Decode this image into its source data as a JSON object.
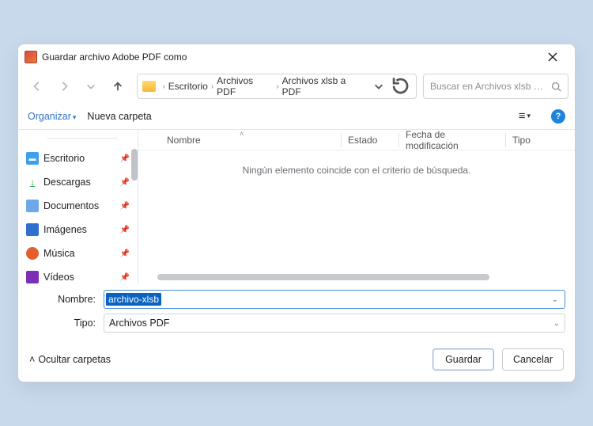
{
  "window_title": "Guardar archivo Adobe PDF como",
  "nav": {
    "path_segments": [
      "Escritorio",
      "Archivos PDF",
      "Archivos xlsb a PDF"
    ],
    "search_placeholder": "Buscar en Archivos xlsb a PDF"
  },
  "toolbar": {
    "organize": "Organizar",
    "new_folder": "Nueva carpeta"
  },
  "sidebar": {
    "items": [
      {
        "label": "Escritorio",
        "color": "#3aa0ef",
        "glyph": "🖥"
      },
      {
        "label": "Descargas",
        "color": "#34a853",
        "glyph": "↓"
      },
      {
        "label": "Documentos",
        "color": "#6fa8e8",
        "glyph": "📄"
      },
      {
        "label": "Imágenes",
        "color": "#2f6fd0",
        "glyph": "🖼"
      },
      {
        "label": "Música",
        "color": "#e65d2e",
        "glyph": "🎵"
      },
      {
        "label": "Vídeos",
        "color": "#7b2fb5",
        "glyph": "▶"
      }
    ]
  },
  "columns": {
    "name": "Nombre",
    "state": "Estado",
    "date": "Fecha de modificación",
    "type": "Tipo"
  },
  "empty_message": "Ningún elemento coincide con el criterio de búsqueda.",
  "fields": {
    "name_label": "Nombre:",
    "name_value": "archivo-xlsb",
    "type_label": "Tipo:",
    "type_value": "Archivos PDF"
  },
  "footer": {
    "hide_folders": "Ocultar carpetas",
    "save": "Guardar",
    "cancel": "Cancelar"
  }
}
